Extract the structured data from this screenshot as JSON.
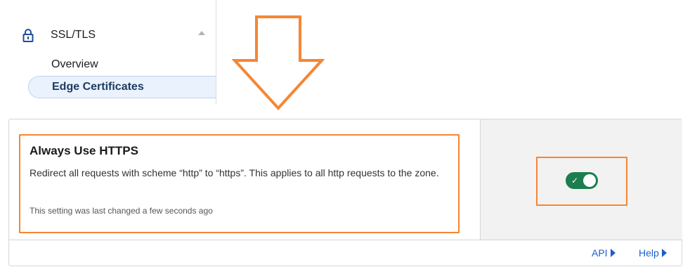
{
  "nav": {
    "group_label": "SSL/TLS",
    "items": [
      {
        "label": "Overview",
        "active": false
      },
      {
        "label": "Edge Certificates",
        "active": true
      }
    ]
  },
  "setting": {
    "title": "Always Use HTTPS",
    "description": "Redirect all requests with scheme “http” to “https”. This applies to all http requests to the zone.",
    "last_changed": "This setting was last changed a few seconds ago",
    "enabled": true
  },
  "footer": {
    "api_label": "API",
    "help_label": "Help"
  },
  "colors": {
    "annotation": "#f58634",
    "toggle_on": "#1c7d4e",
    "link": "#1d5ec9"
  }
}
